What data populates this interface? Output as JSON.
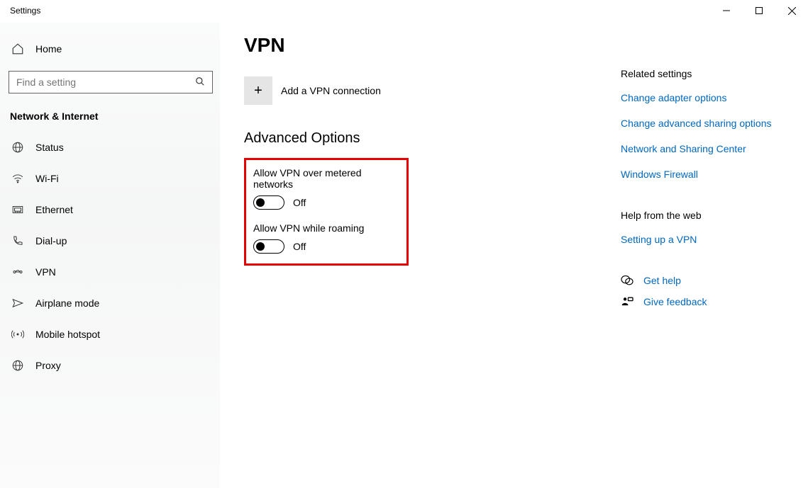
{
  "window": {
    "title": "Settings"
  },
  "sidebar": {
    "home_label": "Home",
    "search_placeholder": "Find a setting",
    "category_label": "Network & Internet",
    "items": [
      {
        "label": "Status"
      },
      {
        "label": "Wi-Fi"
      },
      {
        "label": "Ethernet"
      },
      {
        "label": "Dial-up"
      },
      {
        "label": "VPN"
      },
      {
        "label": "Airplane mode"
      },
      {
        "label": "Mobile hotspot"
      },
      {
        "label": "Proxy"
      }
    ]
  },
  "main": {
    "title": "VPN",
    "add_label": "Add a VPN connection",
    "advanced_heading": "Advanced Options",
    "options": [
      {
        "label": "Allow VPN over metered networks",
        "state": "Off"
      },
      {
        "label": "Allow VPN while roaming",
        "state": "Off"
      }
    ]
  },
  "right": {
    "related_heading": "Related settings",
    "links": [
      "Change adapter options",
      "Change advanced sharing options",
      "Network and Sharing Center",
      "Windows Firewall"
    ],
    "help_heading": "Help from the web",
    "help_links": [
      "Setting up a VPN"
    ],
    "actions": [
      {
        "label": "Get help"
      },
      {
        "label": "Give feedback"
      }
    ]
  }
}
